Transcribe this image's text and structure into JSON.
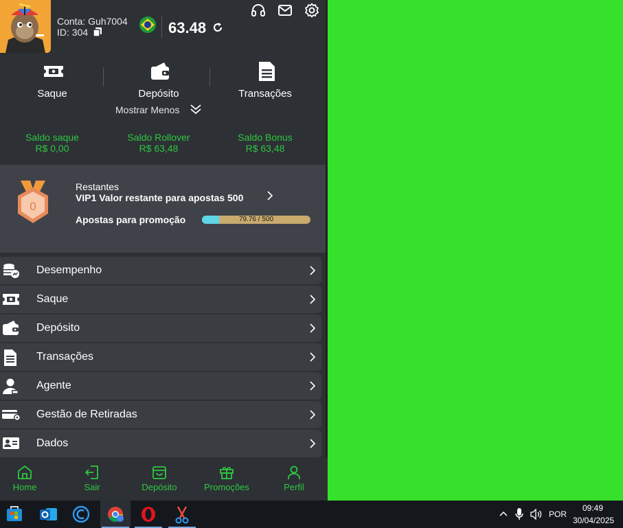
{
  "header": {
    "account_label": "Conta: Guh7004",
    "id_label": "ID: 304",
    "balance": "63.48",
    "icons": [
      "headset-icon",
      "mail-icon",
      "gear-icon"
    ]
  },
  "actions": [
    {
      "label": "Saque",
      "icon": "ticket-icon"
    },
    {
      "label": "Depósito",
      "icon": "wallet-icon"
    },
    {
      "label": "Transações",
      "icon": "document-icon"
    }
  ],
  "show_less": "Mostrar Menos",
  "balances": [
    {
      "label": "Saldo saque",
      "value": "R$ 0,00"
    },
    {
      "label": "Saldo Rollover",
      "value": "R$ 63,48"
    },
    {
      "label": "Saldo Bonus",
      "value": "R$ 63,48"
    }
  ],
  "vip": {
    "medal_level": "0",
    "remaining_label": "Restantes",
    "remaining_text": "VIP1  Valor restante para apostas 500",
    "promo_label": "Apostas para promoção",
    "progress_text": "79.76 / 500",
    "progress_fraction": 0.16
  },
  "menu": [
    {
      "label": "Desempenho",
      "icon": "coins-chart-icon"
    },
    {
      "label": "Saque",
      "icon": "ticket-icon"
    },
    {
      "label": "Depósito",
      "icon": "wallet-icon"
    },
    {
      "label": "Transações",
      "icon": "document-icon"
    },
    {
      "label": "Agente",
      "icon": "agent-icon"
    },
    {
      "label": "Gestão de Retiradas",
      "icon": "card-gear-icon"
    },
    {
      "label": "Dados",
      "icon": "id-card-icon"
    }
  ],
  "bottom_nav": [
    {
      "label": "Home",
      "icon": "home-icon"
    },
    {
      "label": "Sair",
      "icon": "exit-icon"
    },
    {
      "label": "Depósito",
      "icon": "wallet-icon"
    },
    {
      "label": "Promoções",
      "icon": "gift-icon"
    },
    {
      "label": "Perfil",
      "icon": "user-icon"
    }
  ],
  "colors": {
    "accent_green": "#2ec840",
    "panel_bg": "#2d3035",
    "desktop_bg": "#36e12b"
  },
  "taskbar": {
    "language": "POR",
    "time": "09:49",
    "date": "30/04/2025"
  }
}
